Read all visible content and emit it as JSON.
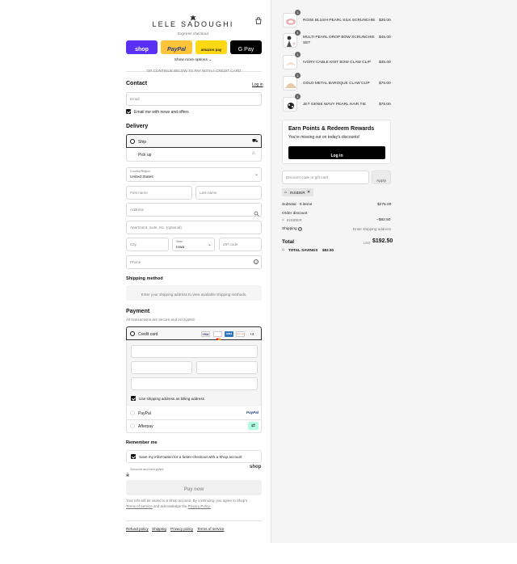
{
  "brand": {
    "logo": "LELE SADOUGHI",
    "subtitle": "Express checkout"
  },
  "express": {
    "shop": "shop",
    "paypal": "PayPal",
    "amazon": "amazon pay",
    "gpay": "G Pay",
    "more": "Show more options",
    "divider": "OR CONTINUE BELOW TO PAY WITH A CREDIT CARD"
  },
  "contact": {
    "title": "Contact",
    "login": "Log in",
    "email_placeholder": "Email",
    "news": "Email me with news and offers"
  },
  "delivery": {
    "title": "Delivery",
    "ship": "Ship",
    "pickup": "Pick up",
    "country_label": "Country/Region",
    "country": "United States",
    "first_name": "First name",
    "last_name": "Last name",
    "address": "Address",
    "apartment": "Apartment, suite, etc. (optional)",
    "city": "City",
    "state_label": "State",
    "state": "Iowa",
    "zip": "ZIP code",
    "phone": "Phone"
  },
  "shipping": {
    "title": "Shipping method",
    "message": "Enter your shipping address to view available shipping methods."
  },
  "payment": {
    "title": "Payment",
    "subtitle": "All transactions are secure and encrypted.",
    "credit_card": "Credit card",
    "card_more": "+4",
    "billing": "Use shipping address as billing address",
    "paypal": "PayPal",
    "paypal_logo": "PayPal",
    "afterpay": "Afterpay",
    "card_brands": [
      "VISA",
      "MC",
      "AMEX",
      "DISCOVER"
    ]
  },
  "remember": {
    "title": "Remember me",
    "save": "Save my information for a faster checkout with a Shop account",
    "secure": "Secured and encrypted",
    "shop": "shop"
  },
  "pay": {
    "button": "Pay now",
    "legal_1": "Your info will be saved to a Shop account. By continuing, you agree to Shop's",
    "terms": "Terms of Service",
    "legal_2": "and acknowledge the",
    "privacy": "Privacy Policy."
  },
  "footer": {
    "links": [
      "Refund policy",
      "Shipping",
      "Privacy policy",
      "Terms of service"
    ]
  },
  "cart": {
    "items": [
      {
        "name": "ROSE BLUSH PEARL SILK SCRUNCHIE",
        "name2": "",
        "price": "$35.00",
        "qty": "1"
      },
      {
        "name": "MULTI PEARL DROP BOW SCRUNCHIE",
        "name2": "SET",
        "price": "$45.00",
        "qty": "1"
      },
      {
        "name": "IVORY CABLE KNIT BOW CLAW CLIP",
        "name2": "",
        "price": "$45.00",
        "qty": "1"
      },
      {
        "name": "GOLD METAL BAROQUE CLAW CLIP",
        "name2": "",
        "price": "$75.00",
        "qty": "1"
      },
      {
        "name": "JET GENIE WAVY PEARL HAIR TIE",
        "name2": "",
        "price": "$75.00",
        "qty": "1"
      }
    ]
  },
  "rewards": {
    "title": "Earn Points & Redeem Rewards",
    "subtitle": "You're missing out on today's discounts!",
    "button": "Log in"
  },
  "discount": {
    "placeholder": "Discount code or gift card",
    "apply": "Apply",
    "tag": "INSIDER"
  },
  "summary": {
    "subtotal_label": "Subtotal · 5 items",
    "subtotal": "$275.00",
    "order_discount": "Order discount",
    "code": "INSIDER",
    "discount": "−$82.50",
    "shipping_label": "Shipping",
    "shipping_value": "Enter shipping address",
    "total_label": "Total",
    "currency": "USD",
    "total": "$192.50",
    "savings_label": "TOTAL SAVINGS",
    "savings": "$82.50"
  }
}
